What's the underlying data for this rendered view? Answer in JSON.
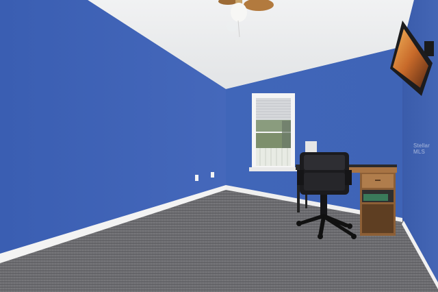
{
  "scene": {
    "watermark": "Stellar MLS",
    "colors": {
      "wall_left": "#3f63b5",
      "wall_back": "#4369bd",
      "wall_right": "#3b5fb0",
      "ceiling": "#eef0f1",
      "carpet": "#6f6f73",
      "baseboard": "#f4f4f4",
      "desk_wood": "#9a6b3f",
      "chair": "#1b1b1e"
    }
  }
}
